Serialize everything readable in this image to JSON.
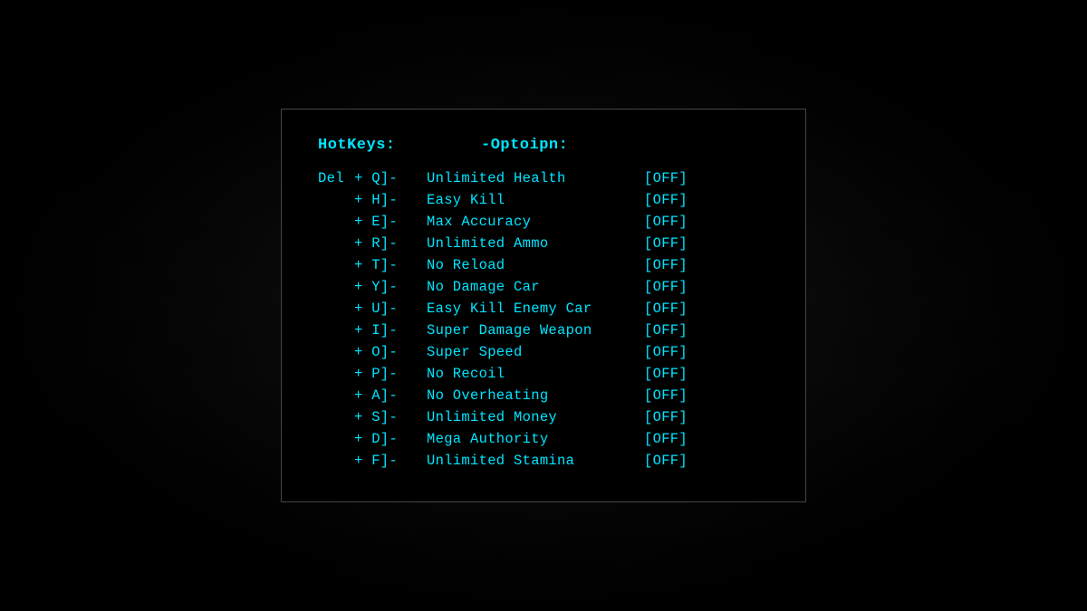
{
  "panel": {
    "header": {
      "col1": "HotKeys:",
      "col2": "-Optoipn:"
    },
    "rows": [
      {
        "del": "Del",
        "key": "+ Q]-",
        "name": "Unlimited Health",
        "status": "[OFF]"
      },
      {
        "del": "",
        "key": "+ H]-",
        "name": "Easy Kill",
        "status": "[OFF]"
      },
      {
        "del": "",
        "key": "+ E]-",
        "name": "Max Accuracy",
        "status": "[OFF]"
      },
      {
        "del": "",
        "key": "+ R]-",
        "name": "Unlimited Ammo",
        "status": "[OFF]"
      },
      {
        "del": "",
        "key": "+ T]-",
        "name": "No Reload",
        "status": "[OFF]"
      },
      {
        "del": "",
        "key": "+ Y]-",
        "name": "No Damage Car",
        "status": "[OFF]"
      },
      {
        "del": "",
        "key": "+ U]-",
        "name": "Easy Kill Enemy Car",
        "status": "[OFF]"
      },
      {
        "del": "",
        "key": "+ I]-",
        "name": "Super Damage Weapon",
        "status": "[OFF]"
      },
      {
        "del": "",
        "key": "+ O]-",
        "name": "Super Speed",
        "status": "[OFF]"
      },
      {
        "del": "",
        "key": "+ P]-",
        "name": "No Recoil",
        "status": "[OFF]"
      },
      {
        "del": "",
        "key": "+ A]-",
        "name": "No Overheating",
        "status": "[OFF]"
      },
      {
        "del": "",
        "key": "+ S]-",
        "name": "Unlimited Money",
        "status": "[OFF]"
      },
      {
        "del": "",
        "key": "+ D]-",
        "name": "Mega Authority",
        "status": "[OFF]"
      },
      {
        "del": "",
        "key": "+ F]-",
        "name": "Unlimited Stamina",
        "status": "[OFF]"
      }
    ]
  }
}
